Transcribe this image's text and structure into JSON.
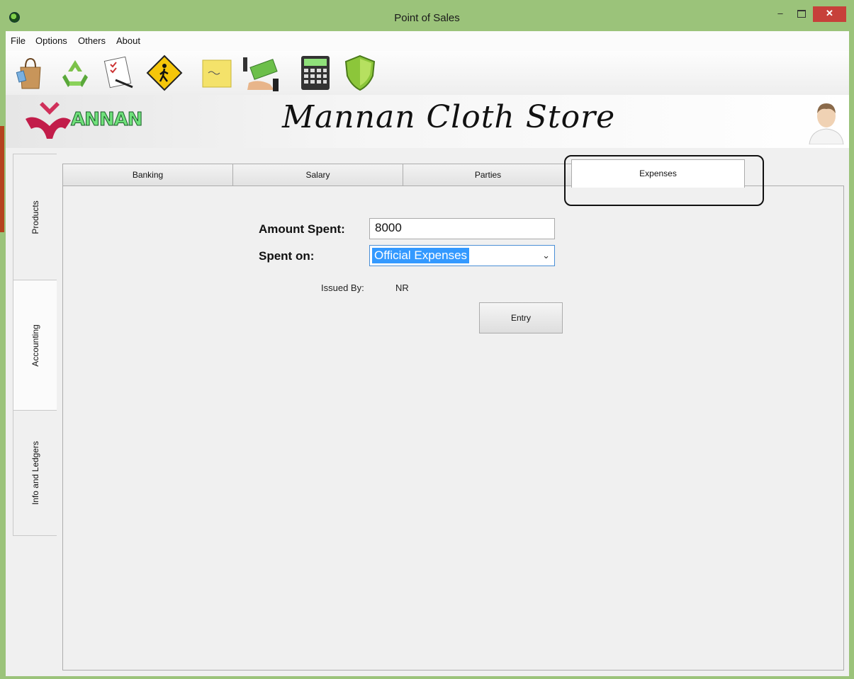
{
  "window": {
    "title": "Point of Sales",
    "close_glyph": "✕",
    "minimize_glyph": "–"
  },
  "menu": {
    "items": [
      "File",
      "Options",
      "Others",
      "About"
    ]
  },
  "toolbar": {
    "icons": [
      "shopping-bag-icon",
      "recycle-icon",
      "checklist-icon",
      "pedestrian-sign-icon",
      "sticky-note-icon",
      "cash-payment-icon",
      "calculator-icon",
      "shield-icon"
    ]
  },
  "banner": {
    "logo_text": "ANNAN",
    "store_name": "Mannan Cloth Store"
  },
  "side_tabs": [
    {
      "label": "Products"
    },
    {
      "label": "Accounting"
    },
    {
      "label": "Info and Ledgers"
    }
  ],
  "tabs": [
    {
      "label": "Banking"
    },
    {
      "label": "Salary"
    },
    {
      "label": "Parties"
    },
    {
      "label": "Expenses"
    }
  ],
  "form": {
    "amount_label": "Amount Spent:",
    "amount_value": "8000",
    "spent_on_label": "Spent on:",
    "spent_on_value": "Official Expenses",
    "issued_by_label": "Issued By:",
    "issued_by_value": "NR",
    "entry_button": "Entry"
  },
  "colors": {
    "title_bar": "#9bc37a",
    "close_button": "#c7403a",
    "selection": "#3399ff"
  }
}
